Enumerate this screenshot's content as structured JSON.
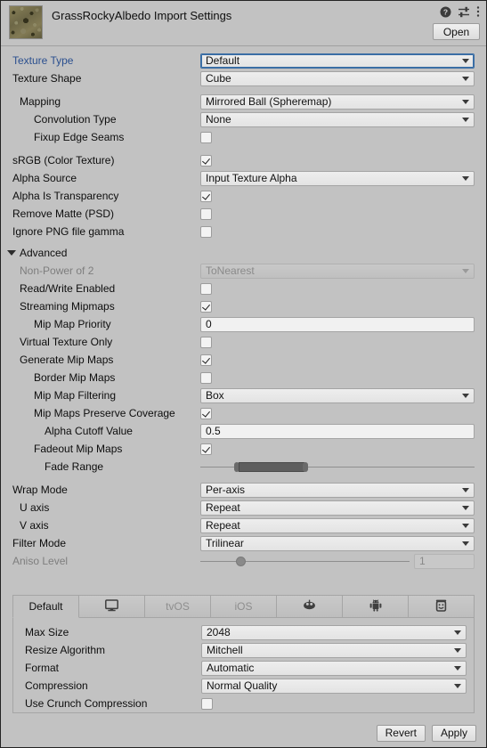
{
  "header": {
    "title": "GrassRockyAlbedo Import Settings",
    "open_label": "Open",
    "icons": [
      "help-icon",
      "preset-icon",
      "more-menu-icon"
    ]
  },
  "settings": {
    "texture_type": {
      "label": "Texture Type",
      "value": "Default"
    },
    "texture_shape": {
      "label": "Texture Shape",
      "value": "Cube"
    },
    "mapping": {
      "label": "Mapping",
      "value": "Mirrored Ball (Spheremap)"
    },
    "convolution_type": {
      "label": "Convolution Type",
      "value": "None"
    },
    "fixup_edge_seams": {
      "label": "Fixup Edge Seams",
      "checked": false
    },
    "srgb": {
      "label": "sRGB (Color Texture)",
      "checked": true
    },
    "alpha_source": {
      "label": "Alpha Source",
      "value": "Input Texture Alpha"
    },
    "alpha_is_transparency": {
      "label": "Alpha Is Transparency",
      "checked": true
    },
    "remove_matte": {
      "label": "Remove Matte (PSD)",
      "checked": false
    },
    "ignore_png_gamma": {
      "label": "Ignore PNG file gamma",
      "checked": false
    }
  },
  "advanced": {
    "label": "Advanced",
    "non_power_of_2": {
      "label": "Non-Power of 2",
      "value": "ToNearest",
      "disabled": true
    },
    "read_write_enabled": {
      "label": "Read/Write Enabled",
      "checked": false
    },
    "streaming_mipmaps": {
      "label": "Streaming Mipmaps",
      "checked": true
    },
    "mip_map_priority": {
      "label": "Mip Map Priority",
      "value": "0"
    },
    "virtual_texture_only": {
      "label": "Virtual Texture Only",
      "checked": false
    },
    "generate_mip_maps": {
      "label": "Generate Mip Maps",
      "checked": true
    },
    "border_mip_maps": {
      "label": "Border Mip Maps",
      "checked": false
    },
    "mip_map_filtering": {
      "label": "Mip Map Filtering",
      "value": "Box"
    },
    "mip_maps_preserve_coverage": {
      "label": "Mip Maps Preserve Coverage",
      "checked": true
    },
    "alpha_cutoff_value": {
      "label": "Alpha Cutoff Value",
      "value": "0.5"
    },
    "fadeout_mip_maps": {
      "label": "Fadeout Mip Maps",
      "checked": true
    },
    "fade_range": {
      "label": "Fade Range"
    }
  },
  "wrap": {
    "wrap_mode": {
      "label": "Wrap Mode",
      "value": "Per-axis"
    },
    "u_axis": {
      "label": "U axis",
      "value": "Repeat"
    },
    "v_axis": {
      "label": "V axis",
      "value": "Repeat"
    },
    "filter_mode": {
      "label": "Filter Mode",
      "value": "Trilinear"
    },
    "aniso_level": {
      "label": "Aniso Level",
      "value": "1",
      "disabled": true
    }
  },
  "platform": {
    "tabs": [
      {
        "label": "Default",
        "icon": "",
        "active": true,
        "dim": false
      },
      {
        "label": "",
        "icon": "monitor-icon",
        "active": false,
        "dim": false
      },
      {
        "label": "tvOS",
        "icon": "",
        "active": false,
        "dim": true
      },
      {
        "label": "iOS",
        "icon": "",
        "active": false,
        "dim": true
      },
      {
        "label": "",
        "icon": "tvos-device-icon",
        "active": false,
        "dim": false
      },
      {
        "label": "",
        "icon": "android-icon",
        "active": false,
        "dim": false
      },
      {
        "label": "",
        "icon": "webgl-icon",
        "active": false,
        "dim": false
      }
    ],
    "max_size": {
      "label": "Max Size",
      "value": "2048"
    },
    "resize_algorithm": {
      "label": "Resize Algorithm",
      "value": "Mitchell"
    },
    "format": {
      "label": "Format",
      "value": "Automatic"
    },
    "compression": {
      "label": "Compression",
      "value": "Normal Quality"
    },
    "use_crunch_compression": {
      "label": "Use Crunch Compression",
      "checked": false
    }
  },
  "footer": {
    "revert_label": "Revert",
    "apply_label": "Apply"
  },
  "colors": {
    "panel_bg": "#c2c2c2",
    "accent_blue": "#2a4f8f",
    "focus_border": "#3b6ea5"
  }
}
